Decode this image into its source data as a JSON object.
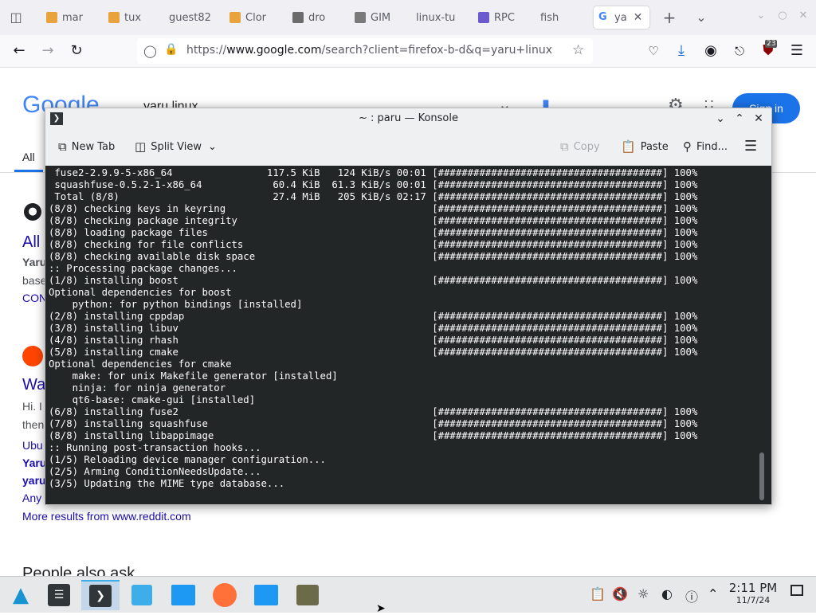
{
  "browser": {
    "tabs": [
      {
        "label": "mar",
        "color": "#e8a33d",
        "active": false
      },
      {
        "label": "tux",
        "color": "#e8a33d",
        "active": false
      },
      {
        "label": "guest82",
        "color": "#3b3b3b",
        "active": false
      },
      {
        "label": "Clor",
        "color": "#e8a33d",
        "active": false
      },
      {
        "label": "dro",
        "color": "#6b6b6b",
        "active": false
      },
      {
        "label": "GIM",
        "color": "#7a7a7a",
        "active": false
      },
      {
        "label": "linux-tu",
        "color": "#cccccc",
        "active": false
      },
      {
        "label": "RPC",
        "color": "#6a5acd",
        "active": false
      },
      {
        "label": "fish",
        "color": "#cccccc",
        "active": false
      },
      {
        "label": "ya",
        "color": "#4285f4",
        "active": true
      }
    ],
    "url_prefix": "https://",
    "url_domain": "www.google.com",
    "url_path": "/search?client=firefox-b-d&q=yaru+linux",
    "extension_badge": "23"
  },
  "google": {
    "logo": "Google",
    "search_query": "yaru linux",
    "sign_in": "Sign in",
    "tab_all": "All",
    "result1_title": "All",
    "result1_bold": "Yaru",
    "result1_text": "base",
    "result1_link": "CON",
    "result2_title": "Wa",
    "result2_text1": "Hi. I",
    "result2_text2": "then",
    "result2_text3": "Ubu",
    "result2_bold1": "Yaru",
    "result2_bold2": "yaru",
    "result2_text4": "Any",
    "more_results": "More results from www.reddit.com",
    "people_also_ask": "People also ask"
  },
  "konsole": {
    "title": "~ : paru — Konsole",
    "toolbar": {
      "new_tab": "New Tab",
      "split_view": "Split View",
      "copy": "Copy",
      "paste": "Paste",
      "find": "Find..."
    },
    "terminal": " fuse2-2.9.9-5-x86_64                117.5 KiB   124 KiB/s 00:01 [######################################] 100%\n squashfuse-0.5.2-1-x86_64            60.4 KiB  61.3 KiB/s 00:01 [######################################] 100%\n Total (8/8)                          27.4 MiB   205 KiB/s 02:17 [######################################] 100%\n(8/8) checking keys in keyring                                   [######################################] 100%\n(8/8) checking package integrity                                 [######################################] 100%\n(8/8) loading package files                                      [######################################] 100%\n(8/8) checking for file conflicts                                [######################################] 100%\n(8/8) checking available disk space                              [######################################] 100%\n:: Processing package changes...\n(1/8) installing boost                                           [######################################] 100%\nOptional dependencies for boost\n    python: for python bindings [installed]\n(2/8) installing cppdap                                          [######################################] 100%\n(3/8) installing libuv                                           [######################################] 100%\n(4/8) installing rhash                                           [######################################] 100%\n(5/8) installing cmake                                           [######################################] 100%\nOptional dependencies for cmake\n    make: for unix Makefile generator [installed]\n    ninja: for ninja generator\n    qt6-base: cmake-gui [installed]\n(6/8) installing fuse2                                           [######################################] 100%\n(7/8) installing squashfuse                                      [######################################] 100%\n(8/8) installing libappimage                                     [######################################] 100%\n:: Running post-transaction hooks...\n(1/5) Reloading device manager configuration...\n(2/5) Arming ConditionNeedsUpdate...\n(3/5) Updating the MIME type database..."
  },
  "taskbar": {
    "time": "2:11 PM",
    "date": "11/7/24"
  },
  "colors": {
    "accent": "#3daee9",
    "google_blue": "#1a73e8",
    "terminal_bg": "#232627"
  }
}
